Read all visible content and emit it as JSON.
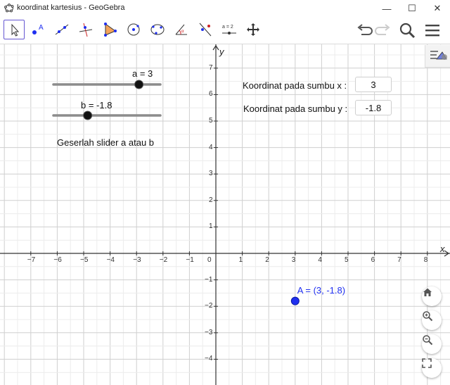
{
  "window": {
    "title": "koordinat kartesius - GeoGebra",
    "minimize": "—",
    "maximize": "☐",
    "close": "✕"
  },
  "toolbar": {
    "tools": [
      "move-tool",
      "point-tool",
      "line-tool",
      "perpendicular-line-tool",
      "polygon-tool",
      "circle-tool",
      "conic-tool",
      "angle-tool",
      "reflect-tool",
      "slider-tool",
      "move-graphics-view-tool"
    ],
    "active_tool": "move-tool",
    "slider_tool_text": "a = 2",
    "undo": "undo-icon",
    "redo": "redo-icon",
    "search": "search-icon",
    "menu": "menu-icon"
  },
  "graphics": {
    "x_axis_label": "x",
    "y_axis_label": "y",
    "x_ticks": [
      "−7",
      "−6",
      "−5",
      "−4",
      "−3",
      "−2",
      "−1",
      "0",
      "1",
      "2",
      "3",
      "4",
      "5",
      "6",
      "7",
      "8"
    ],
    "y_ticks": [
      "7",
      "6",
      "5",
      "4",
      "3",
      "2",
      "1",
      "−1",
      "−2",
      "−3",
      "−4"
    ],
    "x_range": [
      -8,
      8.5
    ],
    "y_range": [
      -4.7,
      7.7
    ],
    "grid": true
  },
  "sliders": [
    {
      "label": "a = 3",
      "min": -5,
      "max": 5,
      "value": 3
    },
    {
      "label": "b = -1.8",
      "min": -5,
      "max": 5,
      "value": -1.8
    }
  ],
  "instruction_text": "Geserlah slider a atau b",
  "inputs": [
    {
      "label": "Koordinat pada sumbu x  :",
      "value": "3"
    },
    {
      "label": "Koordinat pada sumbu y  :",
      "value": "-1.8"
    }
  ],
  "point": {
    "label": "A = (3, -1.8)",
    "x": 3,
    "y": -1.8,
    "color": "#1f2ff0"
  },
  "zoom_buttons": [
    "home-icon",
    "zoom-in-icon",
    "zoom-out-icon",
    "fullscreen-icon"
  ],
  "colors": {
    "accent": "#6557d2",
    "point": "#1f2ff0",
    "grid": "#d9d9d9"
  }
}
